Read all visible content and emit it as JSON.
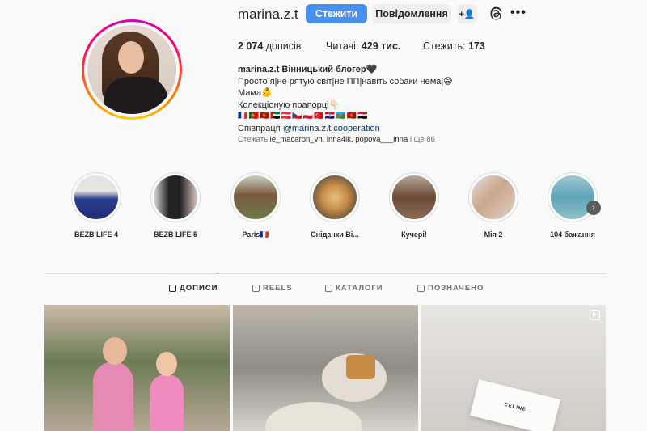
{
  "profile": {
    "username": "marina.z.t",
    "follow_label": "Стежити",
    "message_label": "Повідомлення",
    "adduser_icon": "+👤",
    "more_icon": "•••"
  },
  "stats": {
    "posts_value": "2 074",
    "posts_label": "дописів",
    "followers_label": "Читачі:",
    "followers_value": "429 тис.",
    "following_label": "Стежить:",
    "following_value": "173"
  },
  "bio": {
    "name_line": "marina.z.t Вінницький блогер🖤",
    "line1": "Просто я|не рятую світ|не ПП|навіть собаки нема|😅",
    "line2": "Мама👶",
    "line3": "Колекціоную прапорці👇🏻",
    "flags": "🇫🇷🇵🇹🇲🇪🇦🇪🇦🇹🇨🇿🇵🇱🇹🇷🇭🇷🇦🇿🇲🇪🇪🇬",
    "collab_prefix": "Співпраця ",
    "collab_link": "@marina.z.t.cooperation",
    "followed_prefix": "Стежать ",
    "followed_names": "le_macaron_vn, inna4ik, popova___inna",
    "followed_suffix": " і ще 86"
  },
  "highlights": [
    {
      "label": "BEZB LIFE 4"
    },
    {
      "label": "BEZB LIFE 5"
    },
    {
      "label": "Paris🇫🇷"
    },
    {
      "label": "Сніданки Ві..."
    },
    {
      "label": "Кучері!"
    },
    {
      "label": "Мія 2"
    },
    {
      "label": "104 бажання"
    }
  ],
  "tabs": {
    "posts": "ДОПИСИ",
    "reels": "REELS",
    "catalogs": "КАТАЛОГИ",
    "tagged": "ПОЗНАЧЕНО"
  },
  "posts": {
    "celine_text": "CELINE"
  },
  "colors": {
    "accent": "#4a90f0",
    "link": "#00376b"
  }
}
